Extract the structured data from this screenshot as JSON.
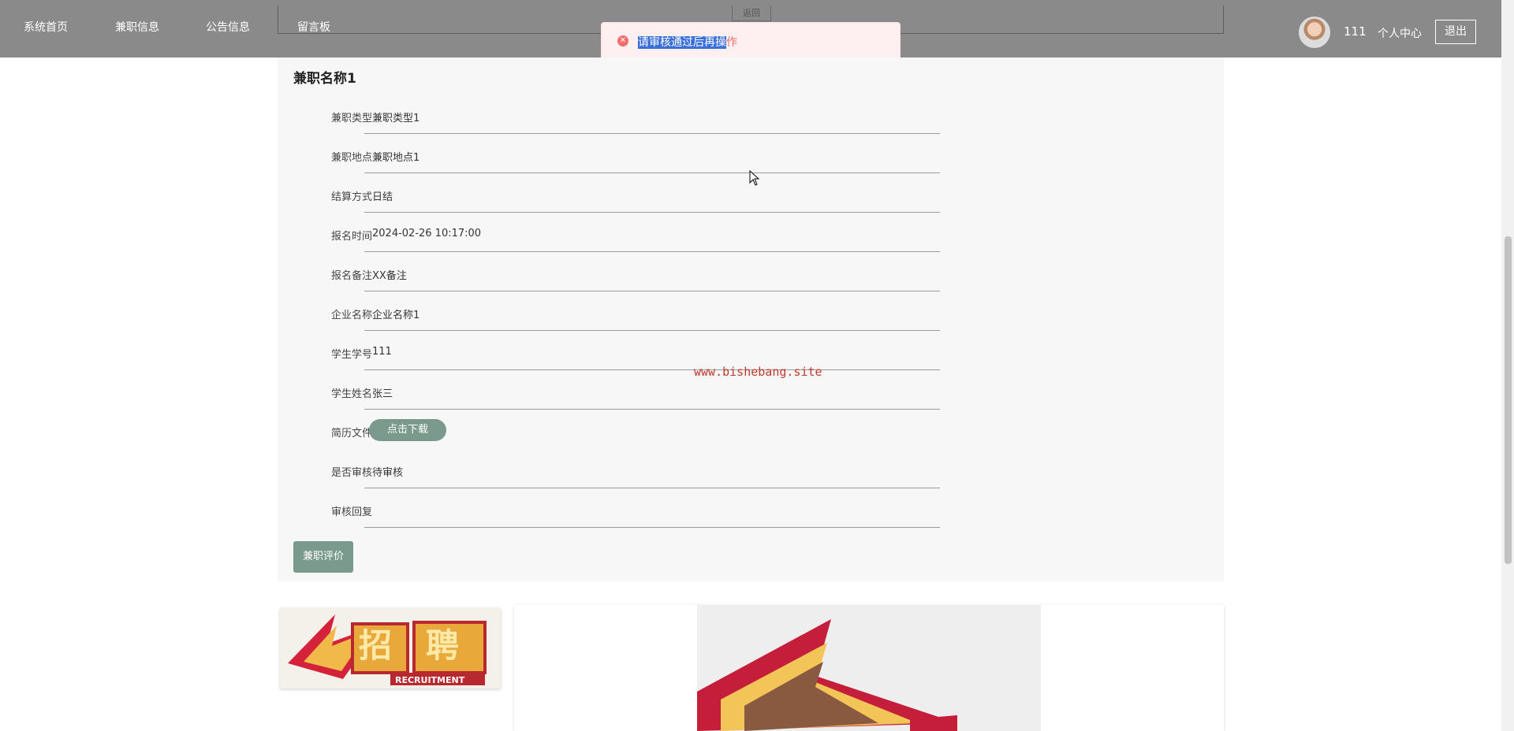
{
  "nav": {
    "items": [
      "系统首页",
      "兼职信息",
      "公告信息",
      "留言板"
    ],
    "return_label": "返回",
    "username": "111",
    "personal_center": "个人中心",
    "logout": "退出"
  },
  "toast": {
    "selected_text": "请审核通过后再操",
    "rest_text": "作",
    "icon": "error-circle-icon"
  },
  "detail": {
    "title": "兼职名称1",
    "fields": [
      {
        "label": "兼职类型",
        "value": "兼职类型1"
      },
      {
        "label": "兼职地点",
        "value": "兼职地点1"
      },
      {
        "label": "结算方式",
        "value": "日结"
      },
      {
        "label": "报名时间",
        "value": "2024-02-26 10:17:00"
      },
      {
        "label": "报名备注",
        "value": "XX备注"
      },
      {
        "label": "企业名称",
        "value": "企业名称1"
      },
      {
        "label": "学生学号",
        "value": "111"
      },
      {
        "label": "学生姓名",
        "value": "张三"
      },
      {
        "label": "简历文件",
        "value": ""
      },
      {
        "label": "是否审核",
        "value": "待审核"
      },
      {
        "label": "审核回复",
        "value": ""
      }
    ],
    "download_button": "点击下载",
    "evaluate_button": "兼职评价"
  },
  "watermark": "www.bishebang.site",
  "banner": {
    "left_image_text": "RECRUITMENT"
  },
  "colors": {
    "nav_bg": "#8a8a8a",
    "accent_button": "#7a9a8d",
    "toast_bg": "#fef0f0",
    "toast_text": "#f56c6c"
  }
}
